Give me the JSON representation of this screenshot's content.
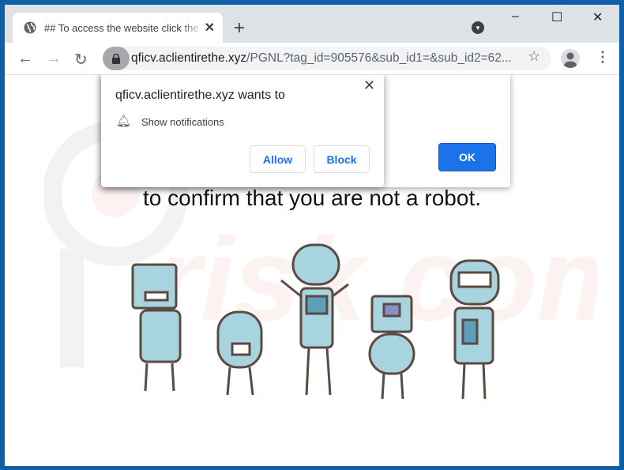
{
  "browser": {
    "tab_title": "## To access the website click the",
    "tab_icon": "globe-icon",
    "url_host": "qficv.aclientirethe.xyz",
    "url_rest": "/PGNL?tag_id=905576&sub_id1=&sub_id2=62...",
    "window_controls": {
      "minimize": "–",
      "maximize": "☐",
      "close": "✕"
    }
  },
  "alert": {
    "message": "to confirm that you are not a robot.",
    "ok_label": "OK"
  },
  "permission": {
    "title": "qficv.aclientirethe.xyz wants to",
    "item": "Show notifications",
    "allow_label": "Allow",
    "block_label": "Block"
  },
  "colors": {
    "accent": "#1a73e8",
    "frame": "#0f5ea8",
    "robot": "#a8d4e0"
  }
}
